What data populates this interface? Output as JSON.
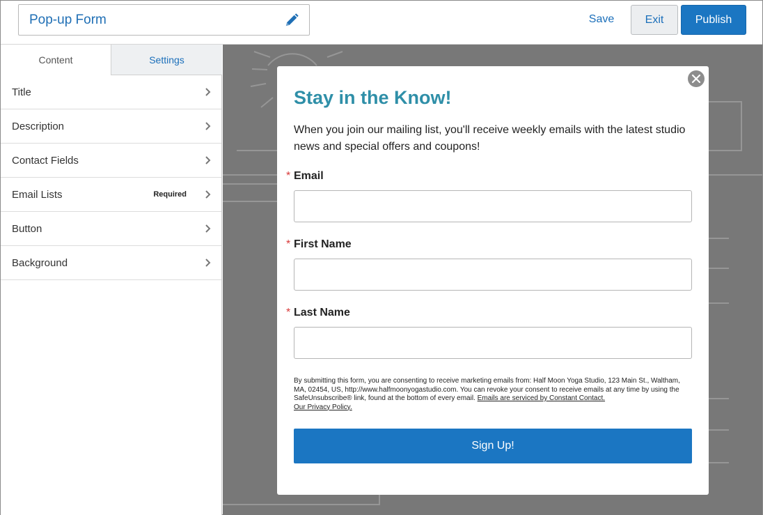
{
  "header": {
    "form_title": "Pop-up Form",
    "save_label": "Save",
    "exit_label": "Exit",
    "publish_label": "Publish"
  },
  "sidebar": {
    "tabs": [
      {
        "label": "Content",
        "active": true
      },
      {
        "label": "Settings",
        "active": false
      }
    ],
    "items": [
      {
        "label": "Title",
        "badge": ""
      },
      {
        "label": "Description",
        "badge": ""
      },
      {
        "label": "Contact Fields",
        "badge": ""
      },
      {
        "label": "Email Lists",
        "badge": "Required"
      },
      {
        "label": "Button",
        "badge": ""
      },
      {
        "label": "Background",
        "badge": ""
      }
    ]
  },
  "form": {
    "title": "Stay in the Know!",
    "description": "When you join our mailing list, you'll receive weekly emails with the latest studio news and special offers and coupons!",
    "required_marker": "*",
    "fields": [
      {
        "label": "Email",
        "value": ""
      },
      {
        "label": "First Name",
        "value": ""
      },
      {
        "label": "Last Name",
        "value": ""
      }
    ],
    "consent_text": "By submitting this form, you are consenting to receive marketing emails from: Half Moon Yoga Studio, 123 Main St., Waltham, MA, 02454, US, http://www.halfmoonyogastudio.com. You can revoke your consent to receive emails at any time by using the SafeUnsubscribe® link, found at the bottom of every email. ",
    "consent_link1": "Emails are serviced by Constant Contact.",
    "consent_link2": "Our Privacy Policy.",
    "button_label": "Sign Up!"
  },
  "colors": {
    "accent": "#1b76c2",
    "title_teal": "#2f8fa8",
    "required_red": "#d83a3a",
    "canvas_gray": "#787878"
  },
  "icons": {
    "edit": "pencil-icon",
    "close": "close-icon",
    "chevron": "chevron-right-icon"
  }
}
